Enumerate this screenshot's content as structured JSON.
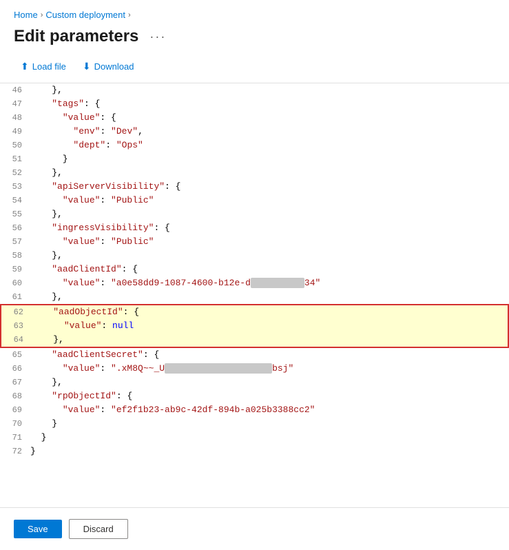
{
  "breadcrumb": {
    "home": "Home",
    "custom_deployment": "Custom deployment",
    "chevron": "›"
  },
  "page": {
    "title": "Edit parameters",
    "more_label": "···"
  },
  "toolbar": {
    "load_file_label": "Load file",
    "download_label": "Download"
  },
  "code": {
    "lines": [
      {
        "num": "46",
        "tokens": [
          {
            "text": "    },",
            "class": "c-punct"
          }
        ]
      },
      {
        "num": "47",
        "tokens": [
          {
            "text": "    ",
            "class": "c-punct"
          },
          {
            "text": "\"tags\"",
            "class": "c-key"
          },
          {
            "text": ": {",
            "class": "c-punct"
          }
        ]
      },
      {
        "num": "48",
        "tokens": [
          {
            "text": "      ",
            "class": "c-punct"
          },
          {
            "text": "\"value\"",
            "class": "c-key"
          },
          {
            "text": ": {",
            "class": "c-punct"
          }
        ]
      },
      {
        "num": "49",
        "tokens": [
          {
            "text": "        ",
            "class": "c-punct"
          },
          {
            "text": "\"env\"",
            "class": "c-key"
          },
          {
            "text": ": ",
            "class": "c-punct"
          },
          {
            "text": "\"Dev\"",
            "class": "c-str"
          },
          {
            "text": ",",
            "class": "c-punct"
          }
        ]
      },
      {
        "num": "50",
        "tokens": [
          {
            "text": "        ",
            "class": "c-punct"
          },
          {
            "text": "\"dept\"",
            "class": "c-key"
          },
          {
            "text": ": ",
            "class": "c-punct"
          },
          {
            "text": "\"Ops\"",
            "class": "c-str"
          }
        ]
      },
      {
        "num": "51",
        "tokens": [
          {
            "text": "      }",
            "class": "c-punct"
          }
        ]
      },
      {
        "num": "52",
        "tokens": [
          {
            "text": "    },",
            "class": "c-punct"
          }
        ]
      },
      {
        "num": "53",
        "tokens": [
          {
            "text": "    ",
            "class": "c-punct"
          },
          {
            "text": "\"apiServerVisibility\"",
            "class": "c-key"
          },
          {
            "text": ": {",
            "class": "c-punct"
          }
        ]
      },
      {
        "num": "54",
        "tokens": [
          {
            "text": "      ",
            "class": "c-punct"
          },
          {
            "text": "\"value\"",
            "class": "c-key"
          },
          {
            "text": ": ",
            "class": "c-punct"
          },
          {
            "text": "\"Public\"",
            "class": "c-str"
          }
        ]
      },
      {
        "num": "55",
        "tokens": [
          {
            "text": "    },",
            "class": "c-punct"
          }
        ]
      },
      {
        "num": "56",
        "tokens": [
          {
            "text": "    ",
            "class": "c-punct"
          },
          {
            "text": "\"ingressVisibility\"",
            "class": "c-key"
          },
          {
            "text": ": {",
            "class": "c-punct"
          }
        ]
      },
      {
        "num": "57",
        "tokens": [
          {
            "text": "      ",
            "class": "c-punct"
          },
          {
            "text": "\"value\"",
            "class": "c-key"
          },
          {
            "text": ": ",
            "class": "c-punct"
          },
          {
            "text": "\"Public\"",
            "class": "c-str"
          }
        ]
      },
      {
        "num": "58",
        "tokens": [
          {
            "text": "    },",
            "class": "c-punct"
          }
        ]
      },
      {
        "num": "59",
        "tokens": [
          {
            "text": "    ",
            "class": "c-punct"
          },
          {
            "text": "\"aadClientId\"",
            "class": "c-key"
          },
          {
            "text": ": {",
            "class": "c-punct"
          }
        ]
      },
      {
        "num": "60",
        "tokens": [
          {
            "text": "      ",
            "class": "c-punct"
          },
          {
            "text": "\"value\"",
            "class": "c-key"
          },
          {
            "text": ": ",
            "class": "c-punct"
          },
          {
            "text": "\"a0e58dd9-1087-4600-b12e-d",
            "class": "c-str"
          },
          {
            "text": "XXXXXXXXXX",
            "class": "c-redacted"
          },
          {
            "text": "34\"",
            "class": "c-str"
          }
        ]
      },
      {
        "num": "61",
        "tokens": [
          {
            "text": "    },",
            "class": "c-punct"
          }
        ]
      }
    ],
    "highlight_lines": [
      {
        "num": "62",
        "tokens": [
          {
            "text": "    ",
            "class": "c-punct"
          },
          {
            "text": "\"aadObjectId\"",
            "class": "c-key"
          },
          {
            "text": ": {",
            "class": "c-punct"
          }
        ],
        "highlighted": true
      },
      {
        "num": "63",
        "tokens": [
          {
            "text": "      ",
            "class": "c-punct"
          },
          {
            "text": "\"value\"",
            "class": "c-key"
          },
          {
            "text": ": ",
            "class": "c-punct"
          },
          {
            "text": "null",
            "class": "c-null"
          }
        ],
        "highlighted": true
      },
      {
        "num": "64",
        "tokens": [
          {
            "text": "    },",
            "class": "c-punct"
          }
        ],
        "highlighted": true
      }
    ],
    "lines_after": [
      {
        "num": "65",
        "tokens": [
          {
            "text": "    ",
            "class": "c-punct"
          },
          {
            "text": "\"aadClientSecret\"",
            "class": "c-key"
          },
          {
            "text": ": {",
            "class": "c-punct"
          }
        ]
      },
      {
        "num": "66",
        "tokens": [
          {
            "text": "      ",
            "class": "c-punct"
          },
          {
            "text": "\"value\"",
            "class": "c-key"
          },
          {
            "text": ": ",
            "class": "c-punct"
          },
          {
            "text": "\".xM8Q~~_U",
            "class": "c-str"
          },
          {
            "text": "XXXXXXXXXXXXXXXXXXXX",
            "class": "c-redacted"
          },
          {
            "text": "bsj\"",
            "class": "c-str"
          }
        ]
      },
      {
        "num": "67",
        "tokens": [
          {
            "text": "    },",
            "class": "c-punct"
          }
        ]
      },
      {
        "num": "68",
        "tokens": [
          {
            "text": "    ",
            "class": "c-punct"
          },
          {
            "text": "\"rpObjectId\"",
            "class": "c-key"
          },
          {
            "text": ": {",
            "class": "c-punct"
          }
        ]
      },
      {
        "num": "69",
        "tokens": [
          {
            "text": "      ",
            "class": "c-punct"
          },
          {
            "text": "\"value\"",
            "class": "c-key"
          },
          {
            "text": ": ",
            "class": "c-punct"
          },
          {
            "text": "\"ef2f1b23-ab9c-42df-894b-a025b3388cc2\"",
            "class": "c-str"
          }
        ]
      },
      {
        "num": "70",
        "tokens": [
          {
            "text": "    }",
            "class": "c-punct"
          }
        ]
      },
      {
        "num": "71",
        "tokens": [
          {
            "text": "  }",
            "class": "c-punct"
          }
        ]
      },
      {
        "num": "72",
        "tokens": [
          {
            "text": "}",
            "class": "c-punct"
          }
        ]
      }
    ]
  },
  "footer": {
    "save_label": "Save",
    "discard_label": "Discard"
  }
}
